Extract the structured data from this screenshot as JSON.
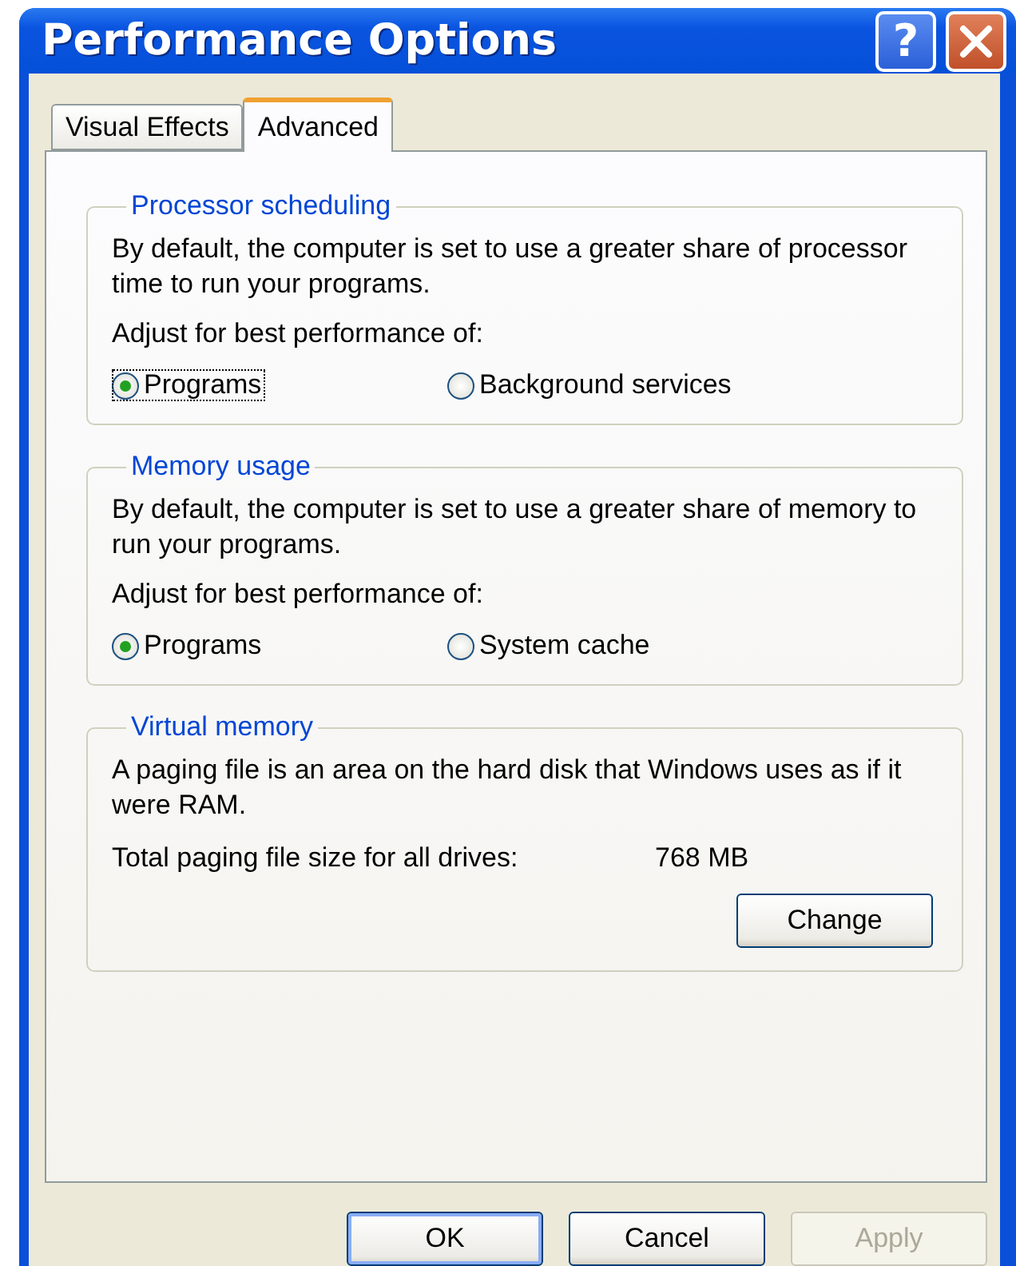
{
  "window": {
    "title": "Performance Options",
    "help_button": "?"
  },
  "tabs": [
    {
      "label": "Visual Effects",
      "selected": false
    },
    {
      "label": "Advanced",
      "selected": true
    }
  ],
  "groups": [
    {
      "kind": "choice",
      "title": "Processor scheduling",
      "description": "By default, the computer is set to use a greater share of processor time to run your programs.",
      "prompt": "Adjust for best performance of:",
      "options": [
        {
          "label": "Programs",
          "selected": true,
          "focused": true
        },
        {
          "label": "Background services",
          "selected": false,
          "focused": false
        }
      ]
    },
    {
      "kind": "choice",
      "title": "Memory usage",
      "description": "By default, the computer is set to use a greater share of memory to run your programs.",
      "prompt": "Adjust for best performance of:",
      "options": [
        {
          "label": "Programs",
          "selected": true,
          "focused": false
        },
        {
          "label": "System cache",
          "selected": false,
          "focused": false
        }
      ]
    },
    {
      "kind": "info",
      "title": "Virtual memory",
      "description": "A paging file is an area on the hard disk that Windows uses as if it were RAM.",
      "row": {
        "label": "Total paging file size for all drives:",
        "value": "768 MB"
      },
      "button": "Change"
    }
  ],
  "buttons": [
    {
      "label": "OK",
      "default": true,
      "disabled": false
    },
    {
      "label": "Cancel",
      "default": false,
      "disabled": false
    },
    {
      "label": "Apply",
      "default": false,
      "disabled": true
    }
  ]
}
